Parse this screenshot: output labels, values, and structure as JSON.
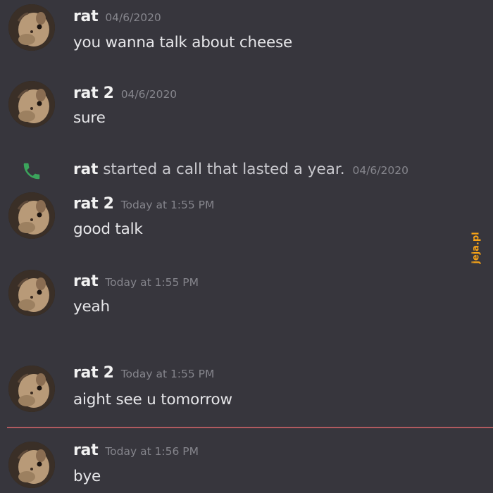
{
  "messages": [
    {
      "username": "rat",
      "timestamp": "04/6/2020",
      "text": "you wanna talk about cheese"
    },
    {
      "username": "rat 2",
      "timestamp": "04/6/2020",
      "text": "sure"
    },
    {
      "username": "rat 2",
      "timestamp": "Today at 1:55 PM",
      "text": "good talk"
    },
    {
      "username": "rat",
      "timestamp": "Today at 1:55 PM",
      "text": "yeah"
    },
    {
      "username": "rat 2",
      "timestamp": "Today at 1:55 PM",
      "text": "aight see u tomorrow"
    },
    {
      "username": "rat",
      "timestamp": "Today at 1:56 PM",
      "text": "bye"
    }
  ],
  "call": {
    "user": "rat",
    "text": " started a call that lasted a year.",
    "timestamp": "04/6/2020"
  },
  "watermark": "jeja.pl",
  "colors": {
    "background": "#37363d",
    "username": "#f2f2f2",
    "timestamp": "#85858c",
    "message_text": "#e6e6e9",
    "call_icon": "#3ba55c",
    "new_messages_divider": "#b05a5f",
    "watermark": "#f6a317"
  },
  "icons": {
    "call": "phone-icon",
    "avatar": "rat-avatar"
  }
}
